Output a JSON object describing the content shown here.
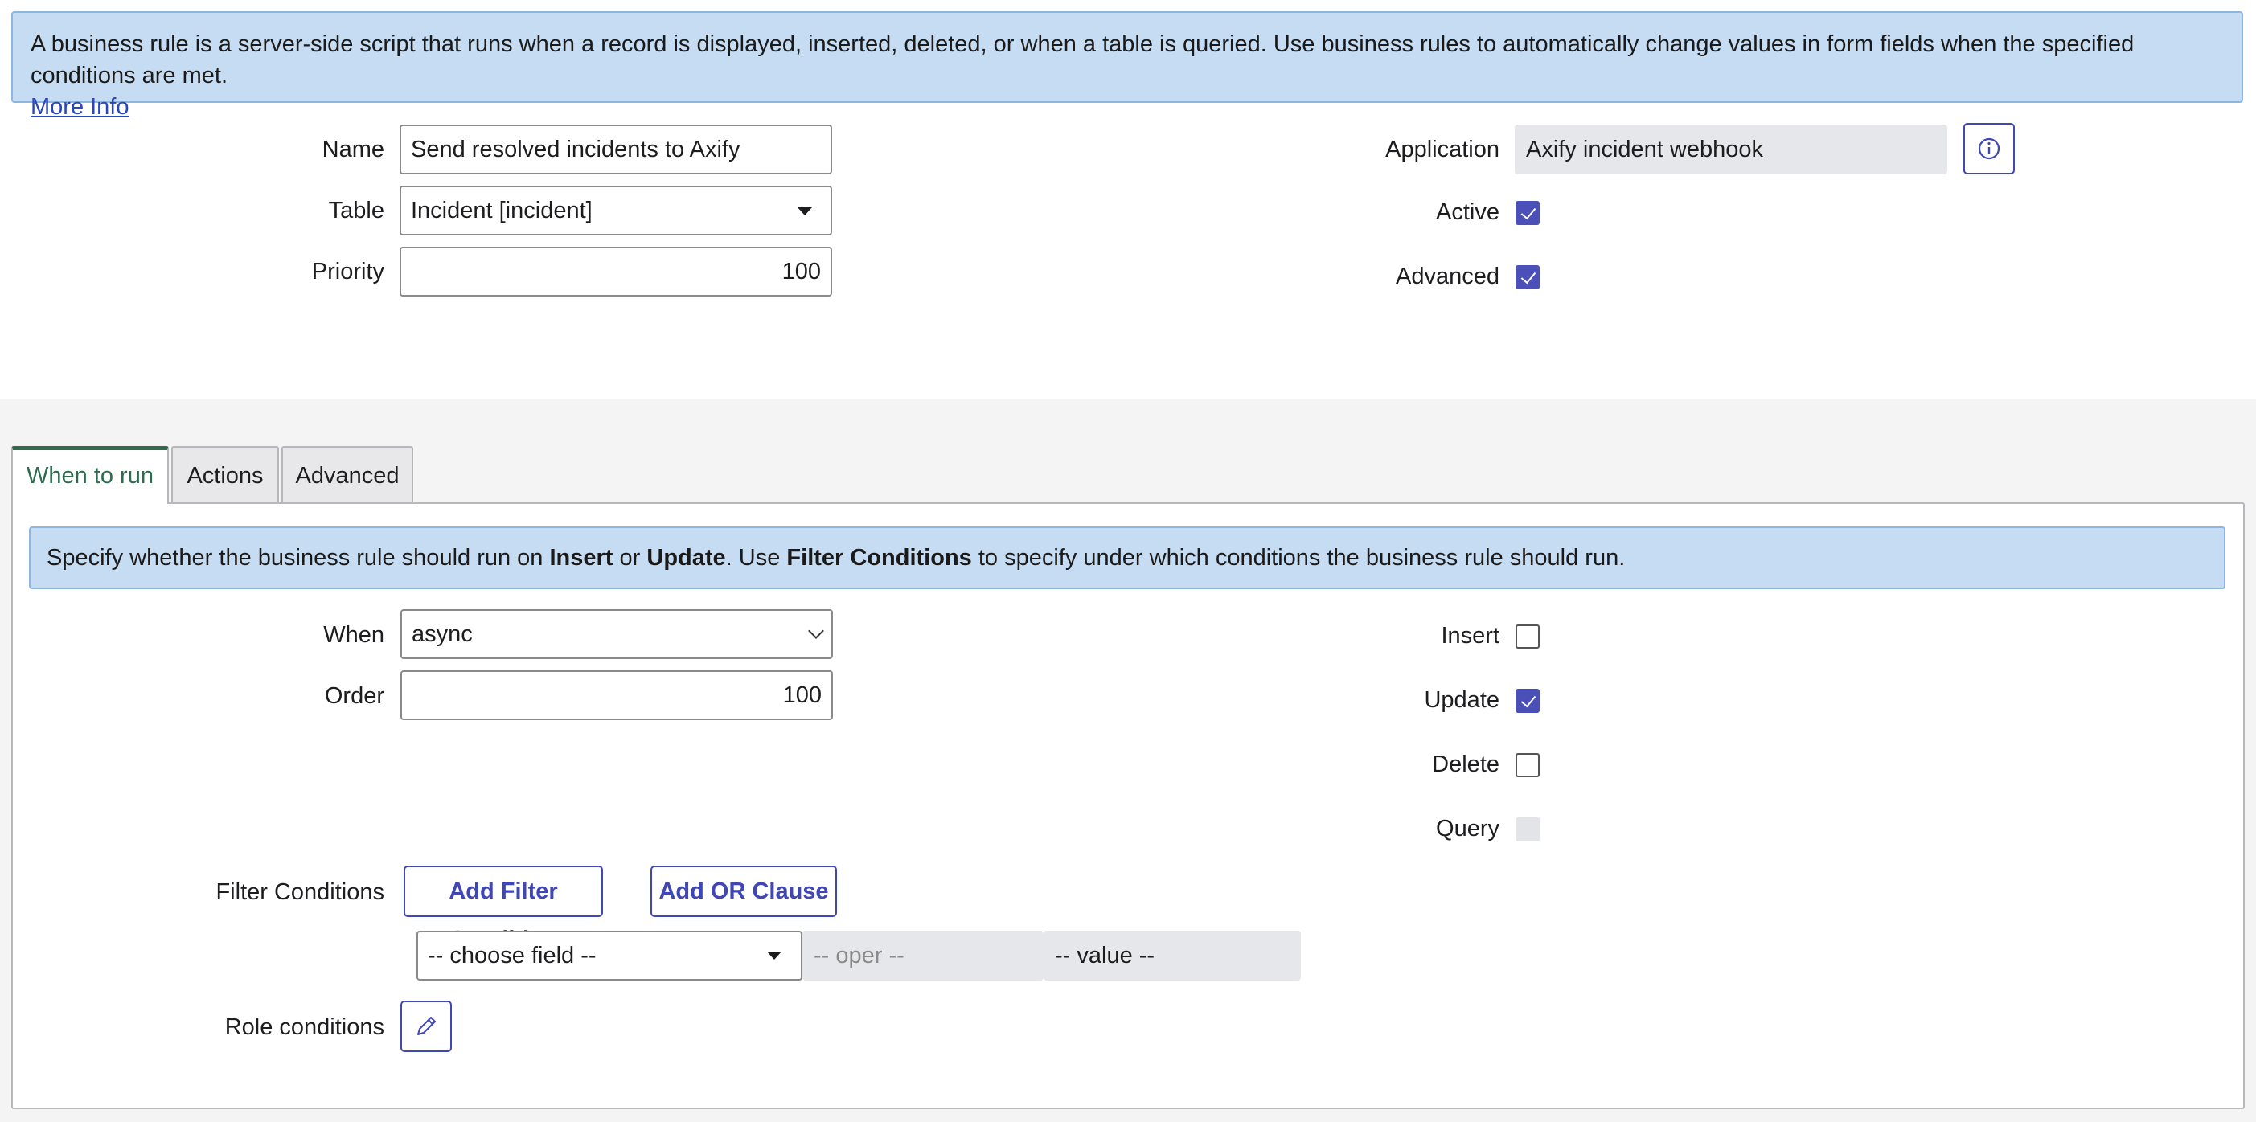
{
  "info": {
    "text": "A business rule is a server-side script that runs when a record is displayed, inserted, deleted, or when a table is queried. Use business rules to automatically change values in form fields when the specified conditions are met.",
    "more_info": "More Info"
  },
  "form": {
    "name_label": "Name",
    "name_value": "Send resolved incidents to Axify",
    "table_label": "Table",
    "table_value": "Incident [incident]",
    "priority_label": "Priority",
    "priority_value": "100",
    "application_label": "Application",
    "application_value": "Axify incident webhook",
    "active_label": "Active",
    "active_checked": true,
    "advanced_label": "Advanced",
    "advanced_checked": true
  },
  "tabs": [
    {
      "label": "When to run",
      "active": true
    },
    {
      "label": "Actions",
      "active": false
    },
    {
      "label": "Advanced",
      "active": false
    }
  ],
  "when_to_run": {
    "banner": {
      "p1": "Specify whether the business rule should run on ",
      "b1": "Insert",
      "p2": " or ",
      "b2": "Update",
      "p3": ". Use ",
      "b3": "Filter Conditions",
      "p4": " to specify under which conditions the business rule should run."
    },
    "when_label": "When",
    "when_value": "async",
    "order_label": "Order",
    "order_value": "100",
    "insert_label": "Insert",
    "insert_checked": false,
    "update_label": "Update",
    "update_checked": true,
    "delete_label": "Delete",
    "delete_checked": false,
    "query_label": "Query",
    "query_disabled": true,
    "filter_label": "Filter Conditions",
    "add_filter_button": "Add Filter Condition",
    "add_or_button": "Add OR Clause",
    "choose_field": "-- choose field --",
    "oper": "-- oper --",
    "value": "-- value --",
    "role_label": "Role conditions"
  },
  "colors": {
    "banner_bg": "#c6dcf2",
    "accent": "#4b4fb8",
    "active_tab": "#2e6b4f"
  }
}
